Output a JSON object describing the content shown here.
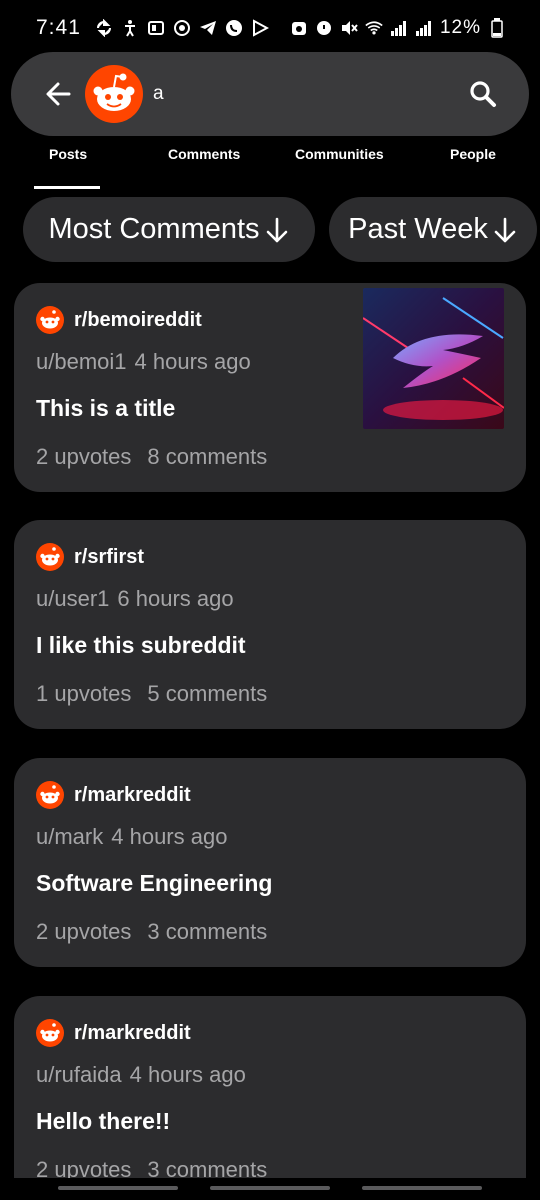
{
  "status_bar": {
    "time": "7:41",
    "battery": "12%",
    "left_icons": [
      "sync-icon",
      "accessibility-icon",
      "dual-sim-icon",
      "aim-icon",
      "telegram-icon",
      "whatsapp-icon",
      "play-icon"
    ],
    "right_icons": [
      "alarm-icon",
      "mute-icon",
      "wifi-icon",
      "signal-icon",
      "signal-2-icon",
      "battery-icon"
    ]
  },
  "search": {
    "value": "a",
    "placeholder": ""
  },
  "tabs": [
    {
      "label": "Posts",
      "active": true
    },
    {
      "label": "Comments",
      "active": false
    },
    {
      "label": "Communities",
      "active": false
    },
    {
      "label": "People",
      "active": false
    }
  ],
  "filters": {
    "sort": "Most Comments",
    "time": "Past Week"
  },
  "posts": [
    {
      "subreddit": "r/bemoireddit",
      "author": "u/bemoi1",
      "time": "4 hours ago",
      "title": "This is a title",
      "upvotes": "2 upvotes",
      "comments": "8 comments",
      "has_thumbnail": true
    },
    {
      "subreddit": "r/srfirst",
      "author": "u/user1",
      "time": "6 hours ago",
      "title": "I like this subreddit",
      "upvotes": "1 upvotes",
      "comments": "5 comments",
      "has_thumbnail": false
    },
    {
      "subreddit": "r/markreddit",
      "author": "u/mark",
      "time": "4 hours ago",
      "title": "Software Engineering",
      "upvotes": "2 upvotes",
      "comments": "3 comments",
      "has_thumbnail": false
    },
    {
      "subreddit": "r/markreddit",
      "author": "u/rufaida",
      "time": "4 hours ago",
      "title": "Hello there!!",
      "upvotes": "2 upvotes",
      "comments": "3 comments",
      "has_thumbnail": false
    }
  ],
  "colors": {
    "background": "#000000",
    "card": "#2c2c2e",
    "search_bar": "#3a3a3c",
    "reddit_orange": "#ff4500",
    "muted_text": "#a5a5a7"
  }
}
